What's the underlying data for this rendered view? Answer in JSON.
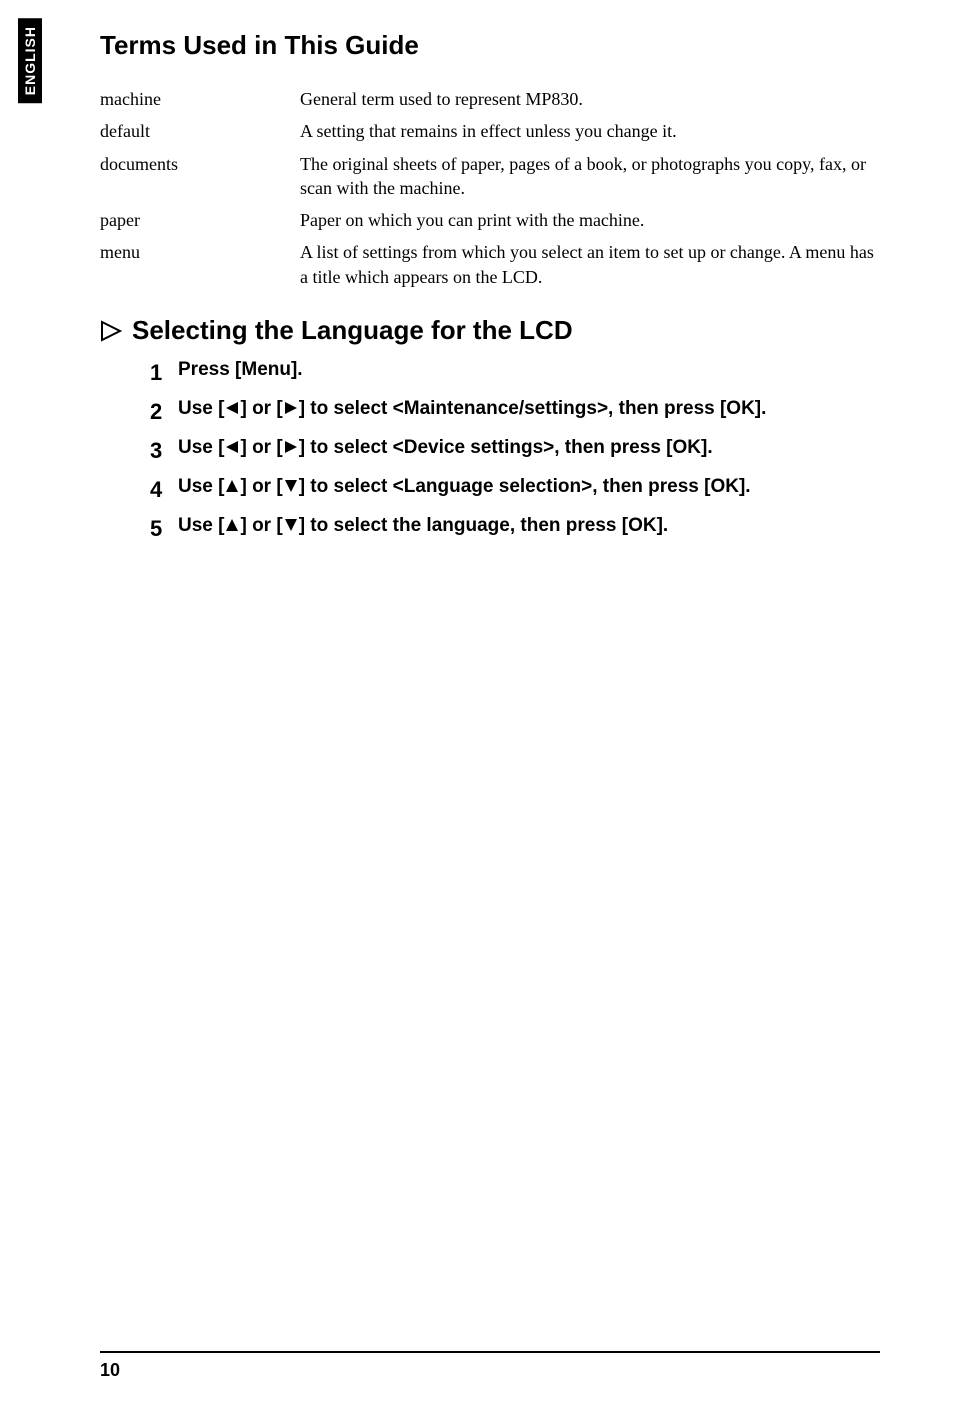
{
  "side_tab": "ENGLISH",
  "terms_title": "Terms Used in This Guide",
  "terms": [
    {
      "term": "machine",
      "def": "General term used to represent MP830."
    },
    {
      "term": "default",
      "def": "A setting that remains in effect unless you change it."
    },
    {
      "term": "documents",
      "def": "The original sheets of paper, pages of a book, or photographs you copy, fax, or scan with the machine."
    },
    {
      "term": "paper",
      "def": "Paper on which you can print with the machine."
    },
    {
      "term": "menu",
      "def": "A list of settings from which you select an item to set up or change. A menu has a title which appears on the LCD."
    }
  ],
  "section_heading": "Selecting the Language for the LCD",
  "steps": [
    {
      "n": "1",
      "parts": [
        "Press [Menu]."
      ]
    },
    {
      "n": "2",
      "parts": [
        "Use [",
        "LEFT",
        "] or [",
        "RIGHT",
        "] to select <Maintenance/settings>, then press [OK]."
      ]
    },
    {
      "n": "3",
      "parts": [
        "Use [",
        "LEFT",
        "] or [",
        "RIGHT",
        "] to select <Device settings>, then press [OK]."
      ]
    },
    {
      "n": "4",
      "parts": [
        "Use [",
        "UP",
        "] or [",
        "DOWN",
        "] to select <Language selection>, then press [OK]."
      ]
    },
    {
      "n": "5",
      "parts": [
        "Use [",
        "UP",
        "] or [",
        "DOWN",
        "] to select the language, then press [OK]."
      ]
    }
  ],
  "page_number": "10"
}
